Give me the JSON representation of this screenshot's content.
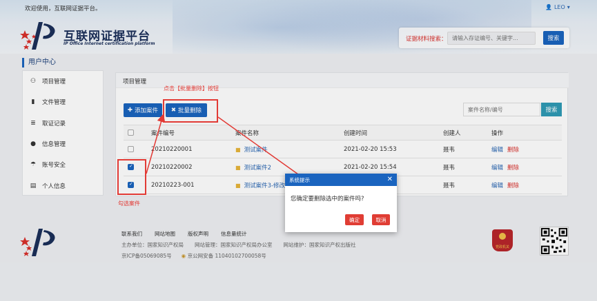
{
  "header": {
    "welcome": "欢迎使用，互联网证据平台。",
    "user": "LEO",
    "brand_title": "互联网证据平台",
    "brand_subtitle": "IP Office Internet certification platform",
    "search_label": "证据材料搜索：",
    "search_placeholder": "请输入存证编号、关键字...",
    "search_button": "搜索"
  },
  "sidebar": {
    "title": "用户中心",
    "items": [
      {
        "label": "项目管理",
        "icon": "sitemap-icon"
      },
      {
        "label": "文件管理",
        "icon": "file-icon"
      },
      {
        "label": "取证记录",
        "icon": "database-icon"
      },
      {
        "label": "信息管理",
        "icon": "comment-icon"
      },
      {
        "label": "账号安全",
        "icon": "umbrella-icon"
      },
      {
        "label": "个人信息",
        "icon": "id-card-icon"
      }
    ]
  },
  "main": {
    "title": "项目管理",
    "add_button": "添加案件",
    "batch_delete_button": "批量删除",
    "filter_placeholder": "案件名称/编号",
    "filter_button": "搜索",
    "columns": [
      "案件编号",
      "案件名称",
      "创建时间",
      "创建人",
      "操作"
    ],
    "rows": [
      {
        "id": "20210220001",
        "name": "测试案件",
        "time": "2021-02-20 15:53",
        "creator": "聂韦",
        "checked": false
      },
      {
        "id": "20210220002",
        "name": "测试案件2",
        "time": "2021-02-20 15:54",
        "creator": "聂韦",
        "checked": true
      },
      {
        "id": "20210223-001",
        "name": "测试案件3-修改",
        "time": "",
        "creator": "聂韦",
        "checked": true
      }
    ],
    "edit_label": "编辑",
    "delete_label": "删除"
  },
  "annotations": {
    "click_note": "点击【批量删除】按钮",
    "select_note": "勾选案件"
  },
  "modal": {
    "title": "系统提示",
    "message": "您确定要删除选中的案件吗?",
    "ok": "确定",
    "cancel": "取消"
  },
  "footer": {
    "links": [
      "联系我们",
      "网站地图",
      "版权声明",
      "信息量统计"
    ],
    "sponsor": "主办单位：国家知识产权局",
    "management": "网站管理：国家知识产权局办公室",
    "maintenance": "网站维护：国家知识产权出版社",
    "icp": "京ICP备05069085号",
    "police": "京公网安备 11040102700058号",
    "badge": "党政机关"
  },
  "colors": {
    "primary": "#1a64bf",
    "danger": "#e03d34",
    "annotation": "#e23a35"
  }
}
